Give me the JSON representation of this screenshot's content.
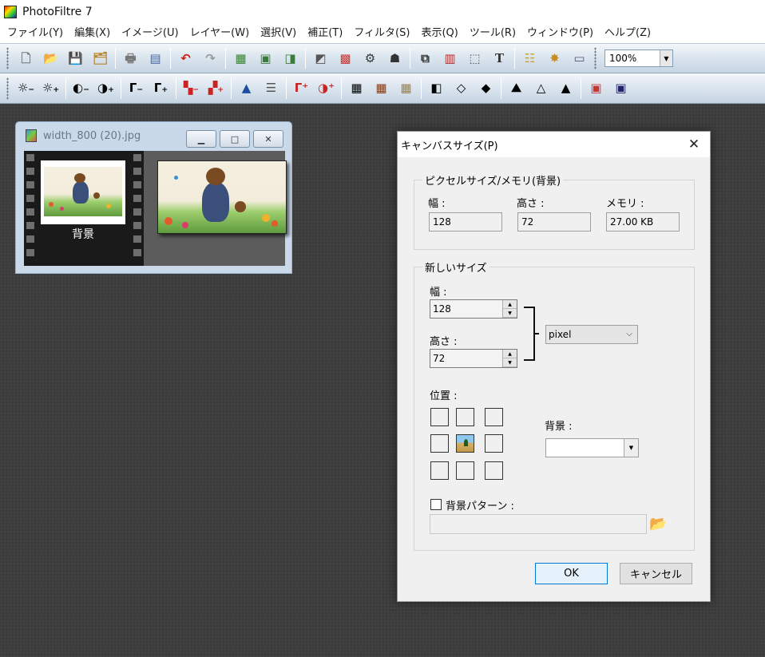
{
  "app": {
    "title": "PhotoFiltre 7"
  },
  "menu": [
    "ファイル(Y)",
    "編集(X)",
    "イメージ(U)",
    "レイヤー(W)",
    "選択(V)",
    "補正(T)",
    "フィルタ(S)",
    "表示(Q)",
    "ツール(R)",
    "ウィンドウ(P)",
    "ヘルプ(Z)"
  ],
  "toolbar": {
    "zoom": "100%"
  },
  "image_window": {
    "filename": "width_800 (20).jpg",
    "layer_label": "背景"
  },
  "dialog": {
    "title": "キャンバスサイズ(P)",
    "pixel_group": {
      "label": "ピクセルサイズ/メモリ(背景)",
      "width_label": "幅 :",
      "height_label": "高さ :",
      "memory_label": "メモリ :",
      "width": "128",
      "height": "72",
      "memory": "27.00 KB"
    },
    "new_group": {
      "label": "新しいサイズ",
      "width_label": "幅 :",
      "height_label": "高さ :",
      "width": "128",
      "height": "72",
      "unit": "pixel",
      "position_label": "位置 :",
      "background_label": "背景 :",
      "pattern_label": "背景パターン :"
    },
    "ok": "OK",
    "cancel": "キャンセル"
  },
  "colors": {
    "accent": "#0078d7",
    "toolbar": "#c6d4e2",
    "workspace": "#3d3d3d"
  }
}
